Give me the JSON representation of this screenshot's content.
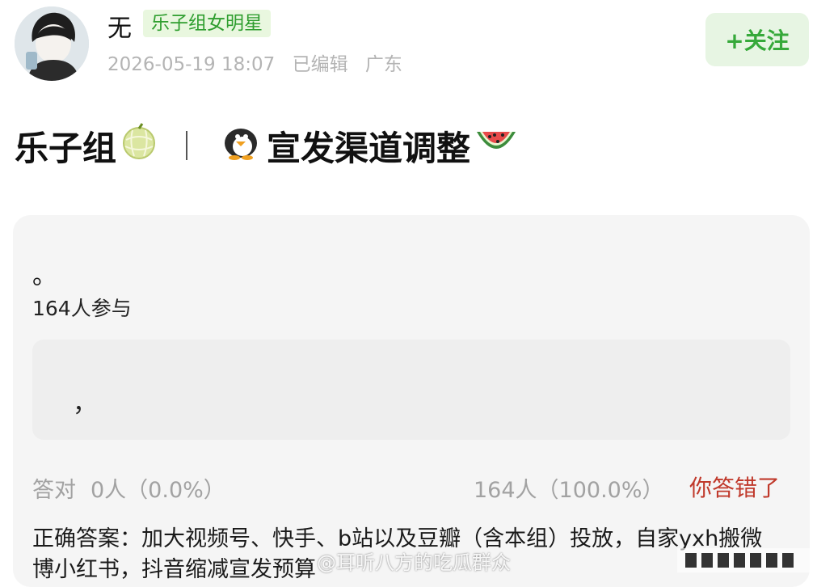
{
  "user": {
    "name": "无",
    "badge": "乐子组女明星",
    "timestamp": "2026-05-19 18:07",
    "edited": "已编辑",
    "location": "广东"
  },
  "follow": {
    "label": "+关注"
  },
  "post": {
    "group": "乐子组",
    "title": "宣发渠道调整",
    "emojis": {
      "group": "melon",
      "title_start": "penguin",
      "title_end": "watermelon"
    }
  },
  "quiz": {
    "question": "。",
    "participants": "164人参与",
    "option_text": "，",
    "correct_label": "答对",
    "correct_stat": "0人（0.0%）",
    "wrong_stat": "164人（100.0%）",
    "result": "你答错了",
    "answer": "正确答案：加大视频号、快手、b站以及豆瓣（含本组）投放，自家yxh搬微博小红书，抖音缩减宣发预算"
  },
  "watermark": {
    "text": "@耳听八方的吃瓜群众"
  },
  "colors": {
    "badge_bg": "#e9f7df",
    "badge_text": "#2f9e2f",
    "follow_bg": "#e7f5e3",
    "follow_text": "#36a93a",
    "wrong_text": "#c0392b",
    "card_bg": "#f5f5f5"
  }
}
